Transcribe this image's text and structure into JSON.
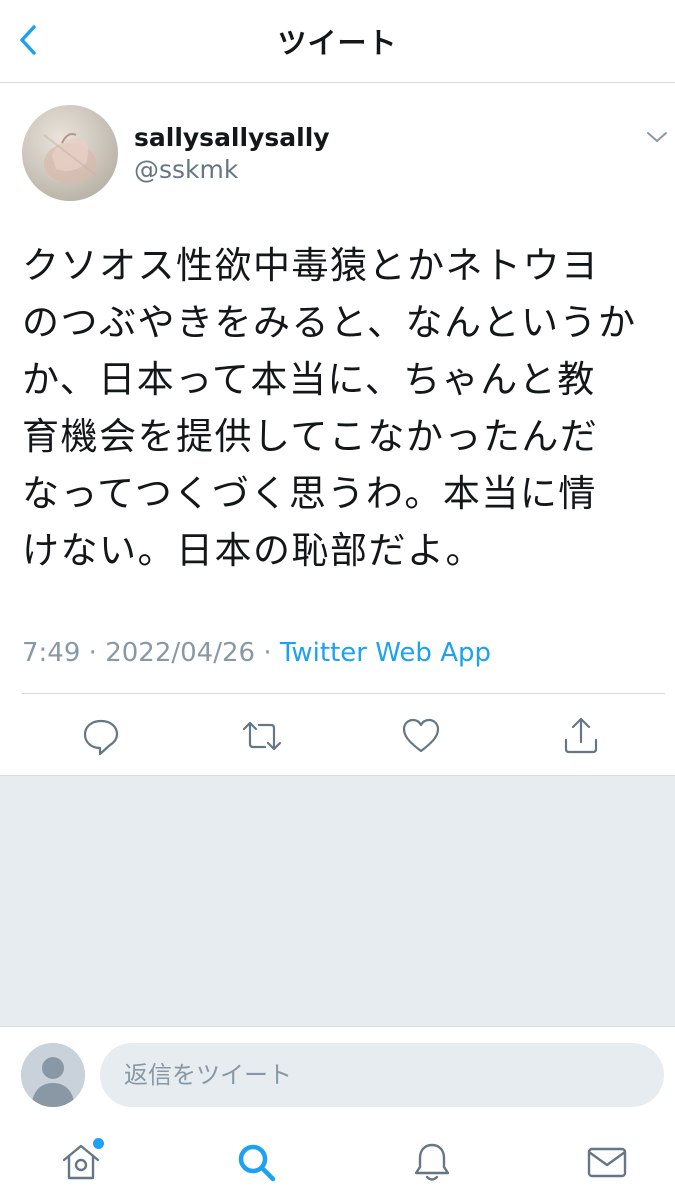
{
  "header": {
    "title": "ツイート",
    "back_icon": "chevron-left-icon"
  },
  "tweet": {
    "display_name": "sallysallysally",
    "handle": "@sskmk",
    "text_lines": [
      "クソオス性欲中毒猿とかネトウヨ",
      "のつぶやきをみると、なんというか",
      "か、日本って本当に、ちゃんと教",
      "育機会を提供してこなかったんだ",
      "なってつくづく思うわ。本当に情",
      "けない。日本の恥部だよ。"
    ],
    "time": "7:49",
    "date": "2022/04/26",
    "separator": "·",
    "source_app": "Twitter Web App",
    "actions": [
      "reply-icon",
      "retweet-icon",
      "like-icon",
      "share-icon"
    ]
  },
  "reply": {
    "placeholder": "返信をツイート"
  },
  "tabbar": {
    "items": [
      "home-icon",
      "search-icon",
      "notifications-icon",
      "messages-icon"
    ],
    "active": "search-icon"
  },
  "colors": {
    "accent": "#1da1f2",
    "icon_gray": "#657786",
    "muted_text": "#8899a6",
    "divider": "#d8dde1",
    "background_gray": "#e6ecf0"
  }
}
